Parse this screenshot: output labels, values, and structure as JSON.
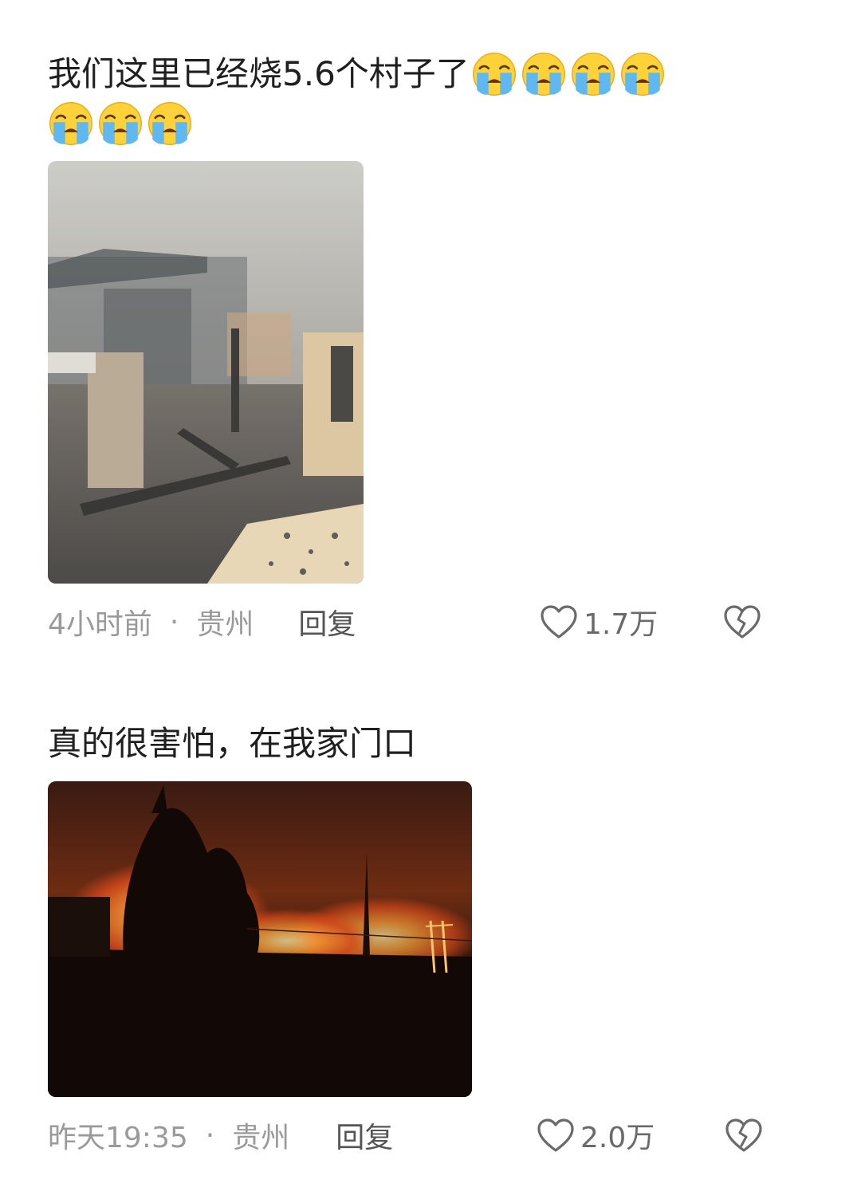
{
  "comments": [
    {
      "text": "我们这里已经烧5.6个村子了",
      "emoji_icon": "loudly-crying-face",
      "emoji_count": 7,
      "photo_icon": "burned-village-ruins-photo",
      "time": "4小时前",
      "separator": "·",
      "location": "贵州",
      "reply_label": "回复",
      "like_count": "1.7万"
    },
    {
      "text": "真的很害怕，在我家门口",
      "photo_icon": "night-wildfire-photo",
      "time": "昨天19:35",
      "separator": "·",
      "location": "贵州",
      "reply_label": "回复",
      "like_count": "2.0万"
    }
  ],
  "colors": {
    "text": "#1f1f1f",
    "meta": "#9a9a9a",
    "icon": "#6a6a6a"
  }
}
